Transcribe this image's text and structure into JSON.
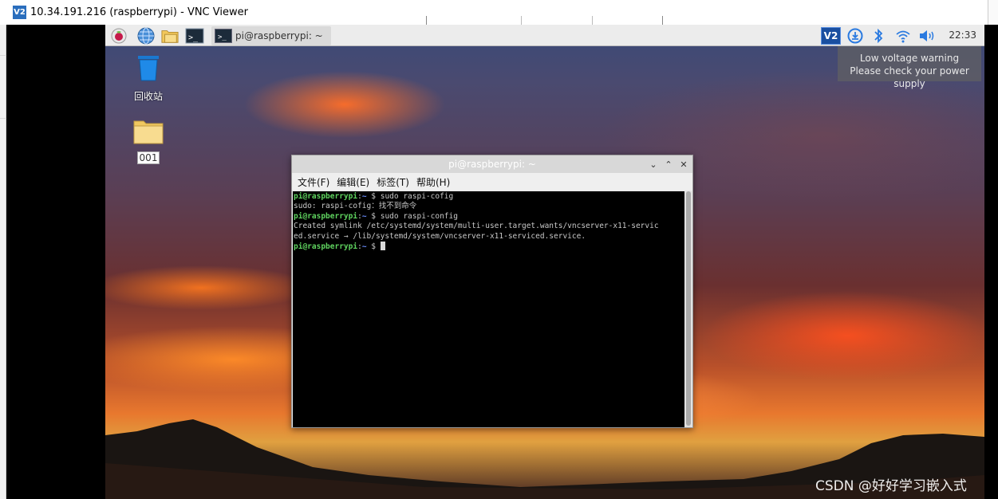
{
  "vnc_window": {
    "logo_text": "V2",
    "title": "10.34.191.216 (raspberrypi) - VNC Viewer"
  },
  "panel": {
    "launcher_icons": [
      "raspberry-menu-icon",
      "browser-globe-icon",
      "file-manager-icon",
      "terminal-icon"
    ],
    "taskbar_item_label": "pi@raspberrypi: ~",
    "tray_icons": [
      "vnc-server-icon",
      "update-download-icon",
      "bluetooth-icon",
      "wifi-icon",
      "volume-icon"
    ],
    "vnc_tray_text": "V2",
    "clock": "22:33"
  },
  "tooltip": {
    "line1": "Low voltage warning",
    "line2": "Please check your power supply"
  },
  "desktop_icons": [
    {
      "label": "回收站",
      "icon": "trash-icon"
    },
    {
      "label": "001",
      "icon": "folder-icon"
    }
  ],
  "terminal": {
    "title": "pi@raspberrypi: ~",
    "window_controls": [
      "minimize",
      "maximize",
      "close"
    ],
    "menu": [
      "文件(F)",
      "编辑(E)",
      "标签(T)",
      "帮助(H)"
    ],
    "lines": [
      {
        "user": "pi@raspberrypi",
        "sep": ":",
        "path": "~",
        "prompt": " $ ",
        "cmd": "sudo raspi-cofig"
      },
      {
        "text": "sudo: raspi-cofig：找不到命令"
      },
      {
        "user": "pi@raspberrypi",
        "sep": ":",
        "path": "~",
        "prompt": " $ ",
        "cmd": "sudo raspi-config"
      },
      {
        "text": "Created symlink /etc/systemd/system/multi-user.target.wants/vncserver-x11-servic"
      },
      {
        "text": "ed.service → /lib/systemd/system/vncserver-x11-serviced.service."
      },
      {
        "user": "pi@raspberrypi",
        "sep": ":",
        "path": "~",
        "prompt": " $ ",
        "cmd": ""
      }
    ]
  },
  "watermark": "CSDN @好好学习嵌入式"
}
